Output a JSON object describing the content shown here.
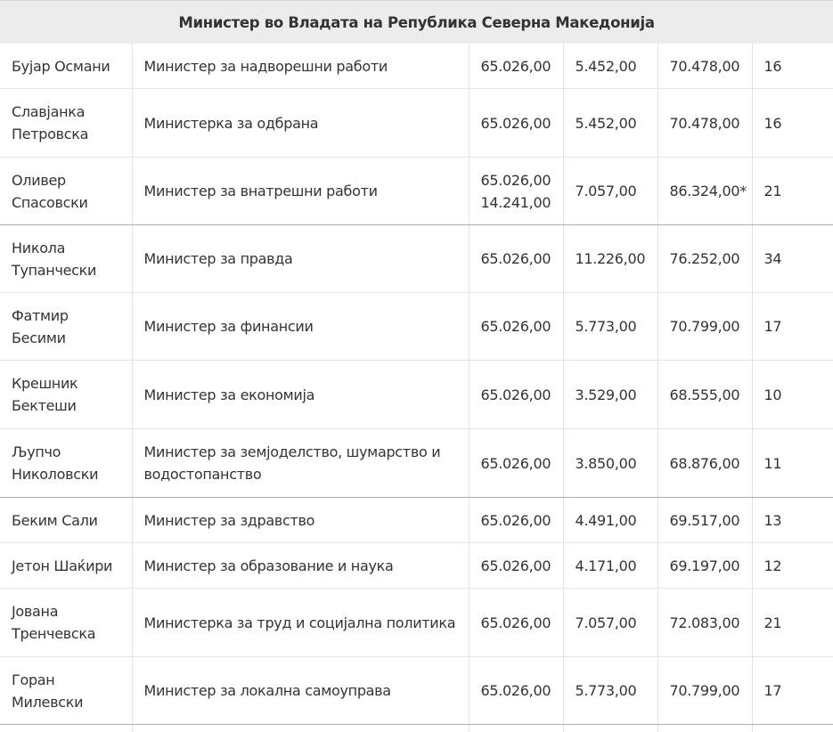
{
  "header": {
    "title": "Министер во Владата на Република Северна Македонија"
  },
  "rows": [
    {
      "name": [
        "Бујар Османи"
      ],
      "role": [
        "Министер за надворешни работи"
      ],
      "base": [
        "65.026,00"
      ],
      "extra": "5.452,00",
      "total": "70.478,00",
      "pct": "16"
    },
    {
      "name": [
        "Славјанка",
        "Петровска"
      ],
      "role": [
        "Министерка за одбрана"
      ],
      "base": [
        "65.026,00"
      ],
      "extra": "5.452,00",
      "total": "70.478,00",
      "pct": "16"
    },
    {
      "name": [
        "Оливер",
        "Спасовски"
      ],
      "role": [
        "Министер за внатрешни работи"
      ],
      "base": [
        "65.026,00",
        "14.241,00"
      ],
      "extra": "7.057,00",
      "total": "86.324,00*",
      "pct": "21"
    },
    {
      "name": [
        "Никола",
        "Тупанчески"
      ],
      "role": [
        "Министер за правда"
      ],
      "base": [
        "65.026,00"
      ],
      "extra": "11.226,00",
      "total": "76.252,00",
      "pct": "34"
    },
    {
      "name": [
        "Фатмир",
        "Бесими"
      ],
      "role": [
        "Министер за финансии"
      ],
      "base": [
        "65.026,00"
      ],
      "extra": "5.773,00",
      "total": "70.799,00",
      "pct": "17"
    },
    {
      "name": [
        "Крешник",
        "Бектеши"
      ],
      "role": [
        "Министер за економија"
      ],
      "base": [
        "65.026,00"
      ],
      "extra": "3.529,00",
      "total": "68.555,00",
      "pct": "10"
    },
    {
      "name": [
        "Љупчо",
        "Николовски"
      ],
      "role": [
        "Министер за земјоделство, шумарство и",
        "водостопанство"
      ],
      "base": [
        "65.026,00"
      ],
      "extra": "3.850,00",
      "total": "68.876,00",
      "pct": "11"
    },
    {
      "name": [
        "Беким Сали"
      ],
      "role": [
        "Министер за здравство"
      ],
      "base": [
        "65.026,00"
      ],
      "extra": "4.491,00",
      "total": "69.517,00",
      "pct": "13"
    },
    {
      "name": [
        "Јетон Шаќири"
      ],
      "role": [
        "Министер за образование и наука"
      ],
      "base": [
        "65.026,00"
      ],
      "extra": "4.171,00",
      "total": "69.197,00",
      "pct": "12"
    },
    {
      "name": [
        "Јована",
        "Тренчевска"
      ],
      "role": [
        "Министерка за труд и социјална политика"
      ],
      "base": [
        "65.026,00"
      ],
      "extra": "7.057,00",
      "total": "72.083,00",
      "pct": "21"
    },
    {
      "name": [
        "Горан",
        "Милевски"
      ],
      "role": [
        "Министер за локална самоуправа"
      ],
      "base": [
        "65.026,00"
      ],
      "extra": "5.773,00",
      "total": "70.799,00",
      "pct": "17"
    }
  ]
}
